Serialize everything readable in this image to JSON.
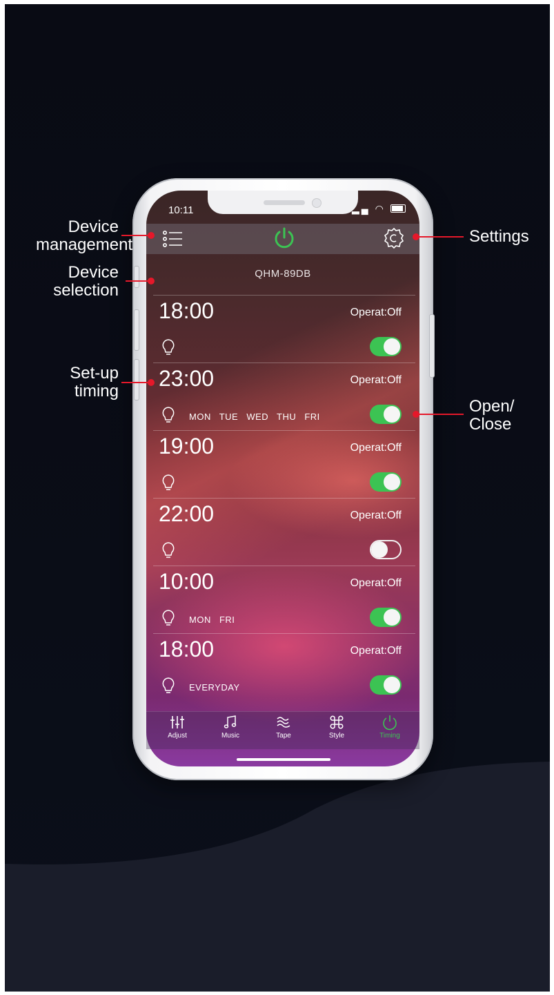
{
  "status": {
    "time": "10:11"
  },
  "header": {
    "device_name": "QHM-89DB"
  },
  "timers": [
    {
      "time": "18:00",
      "operation": "Operat:Off",
      "days": "",
      "enabled": true
    },
    {
      "time": "23:00",
      "operation": "Operat:Off",
      "days": "MON  TUE  WED  THU  FRI",
      "enabled": true
    },
    {
      "time": "19:00",
      "operation": "Operat:Off",
      "days": "",
      "enabled": true
    },
    {
      "time": "22:00",
      "operation": "Operat:Off",
      "days": "",
      "enabled": false
    },
    {
      "time": "10:00",
      "operation": "Operat:Off",
      "days": "MON  FRI",
      "enabled": true
    },
    {
      "time": "18:00",
      "operation": "Operat:Off",
      "days": "EVERYDAY",
      "enabled": true
    }
  ],
  "tabs": [
    {
      "label": "Adjust",
      "icon": "sliders-icon"
    },
    {
      "label": "Music",
      "icon": "music-note-icon"
    },
    {
      "label": "Tape",
      "icon": "wave-icon"
    },
    {
      "label": "Style",
      "icon": "command-icon"
    },
    {
      "label": "Timing",
      "icon": "timer-icon",
      "active": true
    }
  ],
  "callouts": {
    "device_management": "Device\nmanagement",
    "device_selection": "Device\nselection",
    "setup_timing": "Set-up\ntiming",
    "settings": "Settings",
    "open_close": "Open/\nClose"
  },
  "colors": {
    "accent_green": "#3cc353",
    "callout_red": "#e5182a",
    "background": "#0a0d17"
  }
}
